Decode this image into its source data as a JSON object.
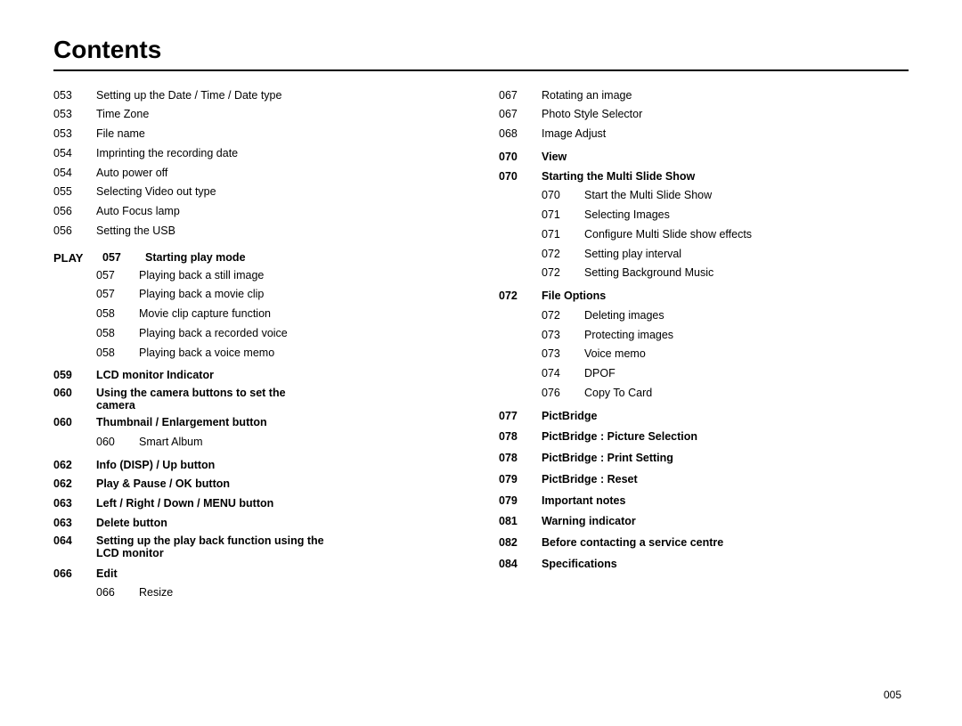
{
  "title": "Contents",
  "left_col": {
    "top_entries": [
      {
        "num": "053",
        "text": "Setting up the Date / Time / Date type",
        "bold": false
      },
      {
        "num": "053",
        "text": "Time Zone",
        "bold": false
      },
      {
        "num": "053",
        "text": "File name",
        "bold": false
      },
      {
        "num": "054",
        "text": "Imprinting the recording date",
        "bold": false
      },
      {
        "num": "054",
        "text": "Auto power off",
        "bold": false
      },
      {
        "num": "055",
        "text": "Selecting Video out type",
        "bold": false
      },
      {
        "num": "056",
        "text": "Auto Focus lamp",
        "bold": false
      },
      {
        "num": "056",
        "text": "Setting the USB",
        "bold": false
      }
    ],
    "play_section": {
      "label": "PLAY",
      "num": "057",
      "heading": "Starting play mode",
      "sub_entries": [
        {
          "num": "057",
          "text": "Playing back a still image"
        },
        {
          "num": "057",
          "text": "Playing back a movie clip"
        },
        {
          "num": "058",
          "text": "Movie clip capture function"
        },
        {
          "num": "058",
          "text": "Playing back a recorded voice"
        },
        {
          "num": "058",
          "text": "Playing back a voice memo"
        }
      ]
    },
    "bold_entries_1": [
      {
        "num": "059",
        "text": "LCD monitor Indicator"
      },
      {
        "num": "060",
        "text": "Using the camera buttons to set the\ncamera"
      },
      {
        "num": "060",
        "text": "Thumbnail / Enlargement button"
      }
    ],
    "sub_thumb": [
      {
        "num": "060",
        "text": "Smart Album"
      }
    ],
    "bold_entries_2": [
      {
        "num": "062",
        "text": "Info (DISP) / Up button"
      },
      {
        "num": "062",
        "text": "Play & Pause / OK button"
      },
      {
        "num": "063",
        "text": "Left / Right / Down / MENU button"
      },
      {
        "num": "063",
        "text": "Delete button"
      },
      {
        "num": "064",
        "text": "Setting up the play back function using the\nLCD monitor"
      }
    ],
    "bold_entries_3": [
      {
        "num": "066",
        "text": "Edit"
      }
    ],
    "sub_edit": [
      {
        "num": "066",
        "text": "Resize"
      }
    ]
  },
  "right_col": {
    "top_entries": [
      {
        "num": "067",
        "text": "Rotating an image",
        "bold": false
      },
      {
        "num": "067",
        "text": "Photo Style Selector",
        "bold": false
      },
      {
        "num": "068",
        "text": "Image Adjust",
        "bold": false
      }
    ],
    "bold_view": {
      "num": "070",
      "text": "View"
    },
    "bold_multi": {
      "num": "070",
      "text": "Starting the Multi Slide Show"
    },
    "sub_multi": [
      {
        "num": "070",
        "text": "Start the Multi Slide Show"
      },
      {
        "num": "071",
        "text": "Selecting Images"
      },
      {
        "num": "071",
        "text": "Configure Multi Slide show effects"
      },
      {
        "num": "072",
        "text": "Setting play interval"
      },
      {
        "num": "072",
        "text": "Setting Background Music"
      }
    ],
    "bold_file": {
      "num": "072",
      "text": "File Options"
    },
    "sub_file": [
      {
        "num": "072",
        "text": "Deleting images"
      },
      {
        "num": "073",
        "text": "Protecting images"
      },
      {
        "num": "073",
        "text": "Voice memo"
      },
      {
        "num": "074",
        "text": "DPOF"
      },
      {
        "num": "076",
        "text": "Copy To Card"
      }
    ],
    "bold_entries": [
      {
        "num": "077",
        "text": "PictBridge"
      },
      {
        "num": "078",
        "text": "PictBridge : Picture Selection"
      },
      {
        "num": "078",
        "text": "PictBridge : Print Setting"
      },
      {
        "num": "079",
        "text": "PictBridge : Reset"
      },
      {
        "num": "079",
        "text": "Important notes"
      },
      {
        "num": "081",
        "text": "Warning indicator"
      },
      {
        "num": "082",
        "text": "Before contacting a service centre"
      },
      {
        "num": "084",
        "text": "Specifications"
      }
    ]
  },
  "page_num": "005"
}
